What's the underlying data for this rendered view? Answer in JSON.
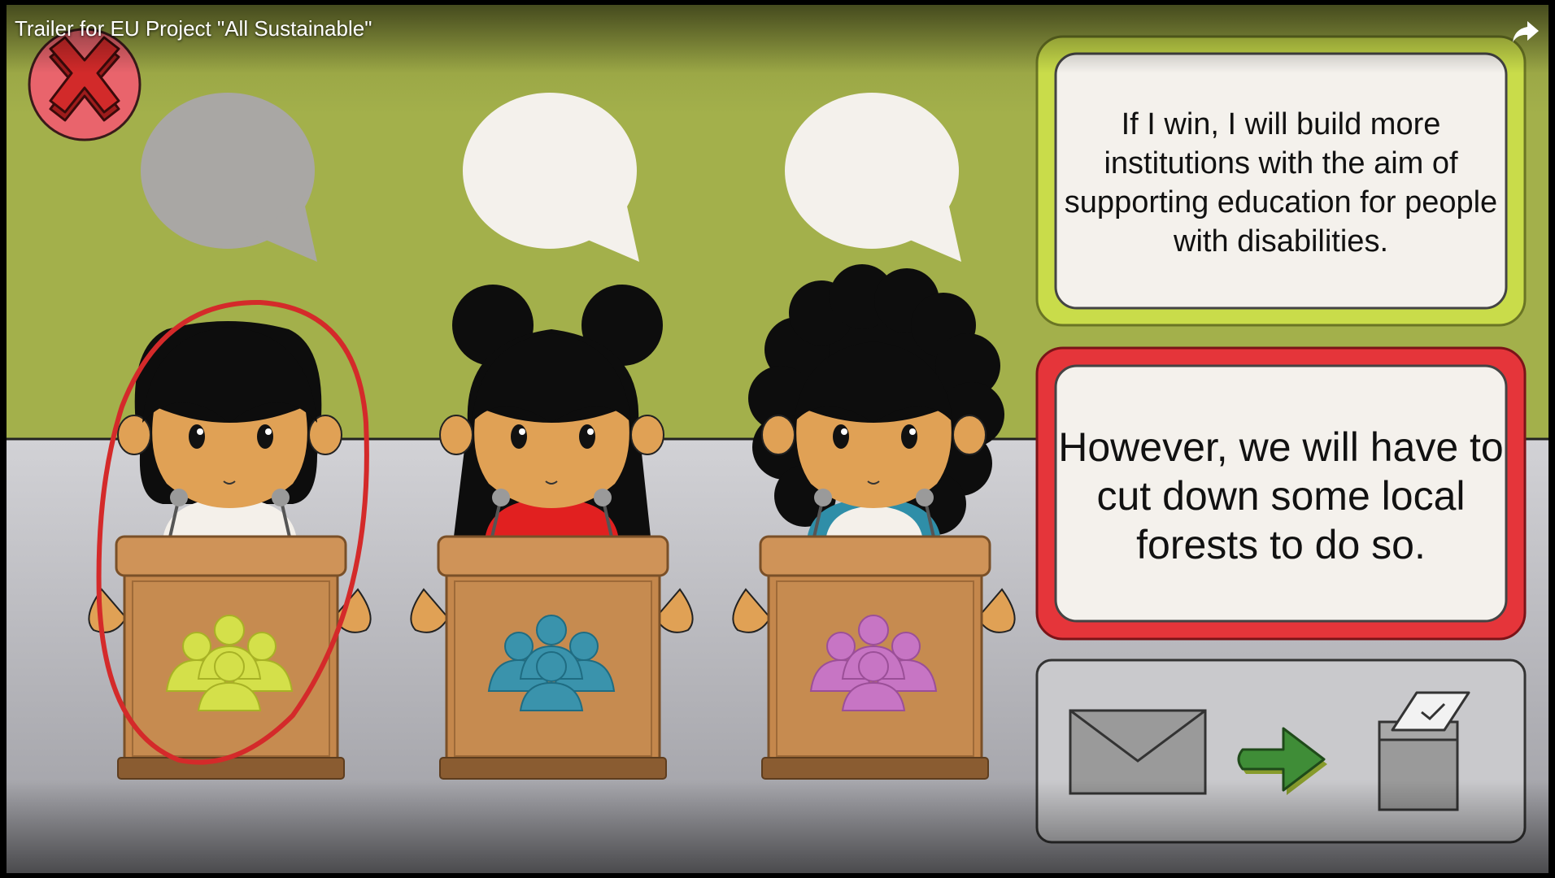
{
  "video": {
    "title": "Trailer for EU Project \"All Sustainable\"",
    "share_icon": "share-arrow-icon",
    "close_icon": "close-x-icon"
  },
  "candidates": [
    {
      "id": "yellow",
      "party_color": "#d4e04a",
      "shirt": "#f4f0ea",
      "hair": "curly-bob",
      "selected": true
    },
    {
      "id": "blue",
      "party_color": "#3a93ac",
      "shirt": "#e12020",
      "hair": "buns",
      "selected": false
    },
    {
      "id": "pink",
      "party_color": "#c775c4",
      "shirt": "#f4f0ea",
      "hair": "afro",
      "selected": false
    }
  ],
  "statements": {
    "promise": "If I win, I will build more institutions with the aim of supporting education for people with disabilities.",
    "consequence": "However, we will have to cut down some local forests to do so."
  },
  "colors": {
    "wall": "#a3b04b",
    "floor": "#c2c2c6",
    "promise_border": "#c9dc4a",
    "consequence_border": "#e5353a",
    "arrow": "#3f8d37",
    "circle_mark": "#d42a2a"
  },
  "vote_panel": {
    "icons": [
      "envelope-icon",
      "arrow-right-icon",
      "ballot-box-icon"
    ]
  }
}
